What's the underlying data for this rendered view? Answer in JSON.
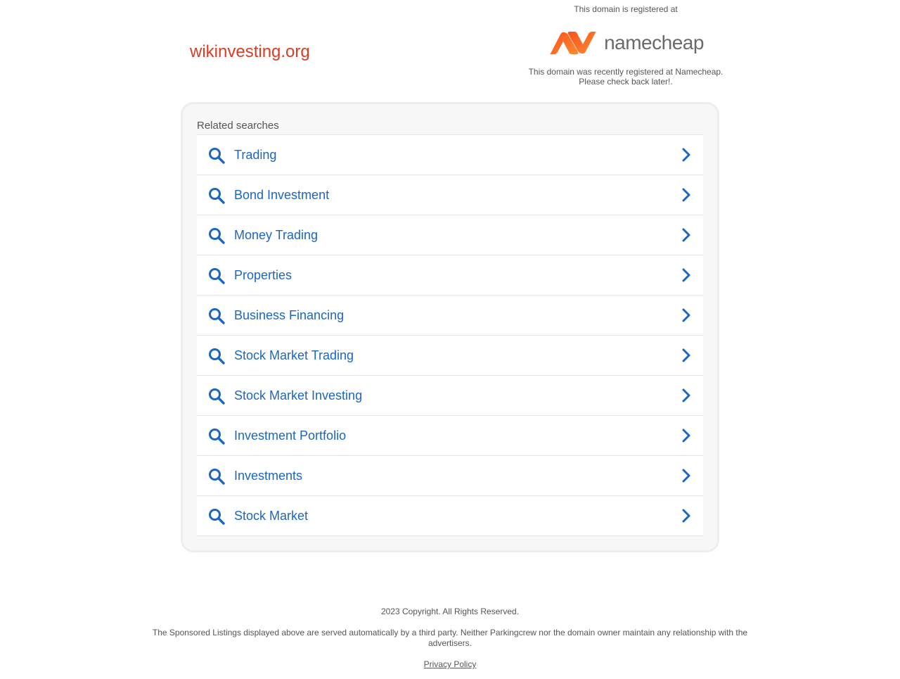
{
  "header": {
    "domain": "wikinvesting.org",
    "registrar_top": "This domain is registered at",
    "registrar_logo_text": "namecheap",
    "registrar_message_1": "This domain was recently registered at Namecheap.",
    "registrar_message_2": "Please check back later!."
  },
  "related": {
    "title": "Related searches",
    "items": [
      {
        "label": "Trading"
      },
      {
        "label": "Bond Investment"
      },
      {
        "label": "Money Trading"
      },
      {
        "label": "Properties"
      },
      {
        "label": "Business Financing"
      },
      {
        "label": "Stock Market Trading"
      },
      {
        "label": "Stock Market Investing"
      },
      {
        "label": "Investment Portfolio"
      },
      {
        "label": "Investments"
      },
      {
        "label": "Stock Market"
      }
    ]
  },
  "footer": {
    "copyright": "2023 Copyright. All Rights Reserved.",
    "disclaimer": "The Sponsored Listings displayed above are served automatically by a third party. Neither Parkingcrew nor the domain owner maintain any relationship with the advertisers.",
    "privacy_policy": "Privacy Policy"
  },
  "colors": {
    "domain": "#dd3b23",
    "link": "#1a66c7",
    "logo_orange": "#f7622b",
    "text_gray": "#555555"
  },
  "icons": {
    "row_leading": "search-icon",
    "row_trailing": "chevron-right-icon"
  }
}
